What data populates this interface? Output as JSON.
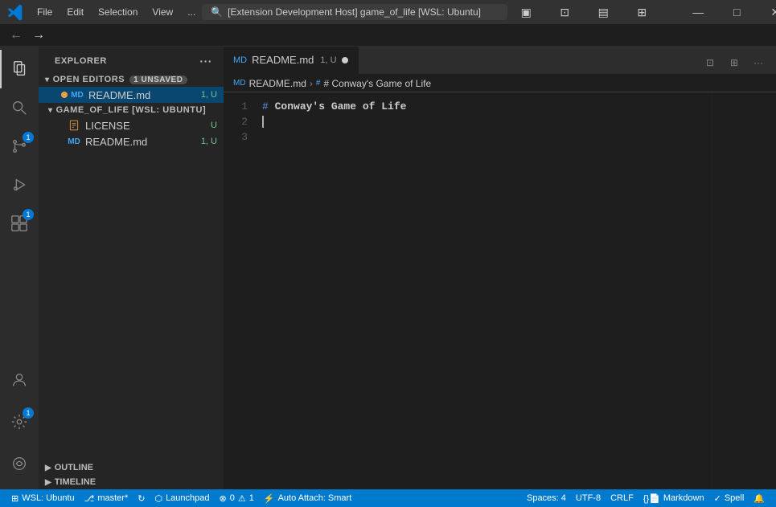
{
  "titlebar": {
    "logo": "vscode-logo",
    "menu": [
      "File",
      "Edit",
      "Selection",
      "View",
      "..."
    ],
    "search_text": "[Extension Development Host] game_of_life [WSL: Ubuntu]",
    "buttons": {
      "layout1": "▣",
      "layout2": "⊡",
      "layout3": "▤",
      "layout4": "⊞",
      "minimize": "—",
      "maximize": "□",
      "close": "✕"
    }
  },
  "activity_bar": {
    "items": [
      {
        "name": "explorer",
        "icon": "files",
        "active": true
      },
      {
        "name": "source-control",
        "icon": "git",
        "active": false,
        "badge": "1"
      },
      {
        "name": "run-debug",
        "icon": "run",
        "active": false
      },
      {
        "name": "extensions",
        "icon": "extensions",
        "active": false,
        "badge": "1"
      },
      {
        "name": "search",
        "icon": "search",
        "active": false
      },
      {
        "name": "remote",
        "icon": "remote",
        "active": false
      }
    ]
  },
  "sidebar": {
    "title": "Explorer",
    "sections": {
      "open_editors": {
        "label": "Open Editors",
        "badge": "1 unsaved",
        "files": [
          {
            "name": "README.md",
            "badge": "1, U",
            "active": true
          }
        ]
      },
      "project": {
        "label": "GAME_OF_LIFE [WSL: UBUNTU]",
        "files": [
          {
            "name": "LICENSE",
            "badge": "U"
          },
          {
            "name": "README.md",
            "badge": "1, U"
          }
        ]
      },
      "outline": {
        "label": "Outline"
      },
      "timeline": {
        "label": "Timeline"
      }
    }
  },
  "editor": {
    "tab": {
      "icon": "md",
      "name": "README.md",
      "state": "1, U",
      "modified": true
    },
    "breadcrumb": {
      "file": "README.md",
      "symbol": "# Conway's Game of Life"
    },
    "lines": [
      {
        "number": "1",
        "content": "# Conway's Game of Life",
        "tokens": [
          {
            "type": "hash",
            "text": "#"
          },
          {
            "type": "heading",
            "text": " Conway's Game of Life"
          }
        ]
      },
      {
        "number": "2",
        "content": ""
      },
      {
        "number": "3",
        "content": ""
      }
    ]
  },
  "status_bar": {
    "wsl": "WSL: Ubuntu",
    "git_branch": "master*",
    "git_sync": "⟲",
    "errors": "0",
    "warnings": "1",
    "launchpad": "Launchpad",
    "no_problems": "0",
    "warnings2": "1",
    "attach": "Auto Attach: Smart",
    "spaces": "Spaces: 4",
    "encoding": "UTF-8",
    "line_endings": "CRLF",
    "language": "Markdown",
    "feedback": "Spell"
  }
}
